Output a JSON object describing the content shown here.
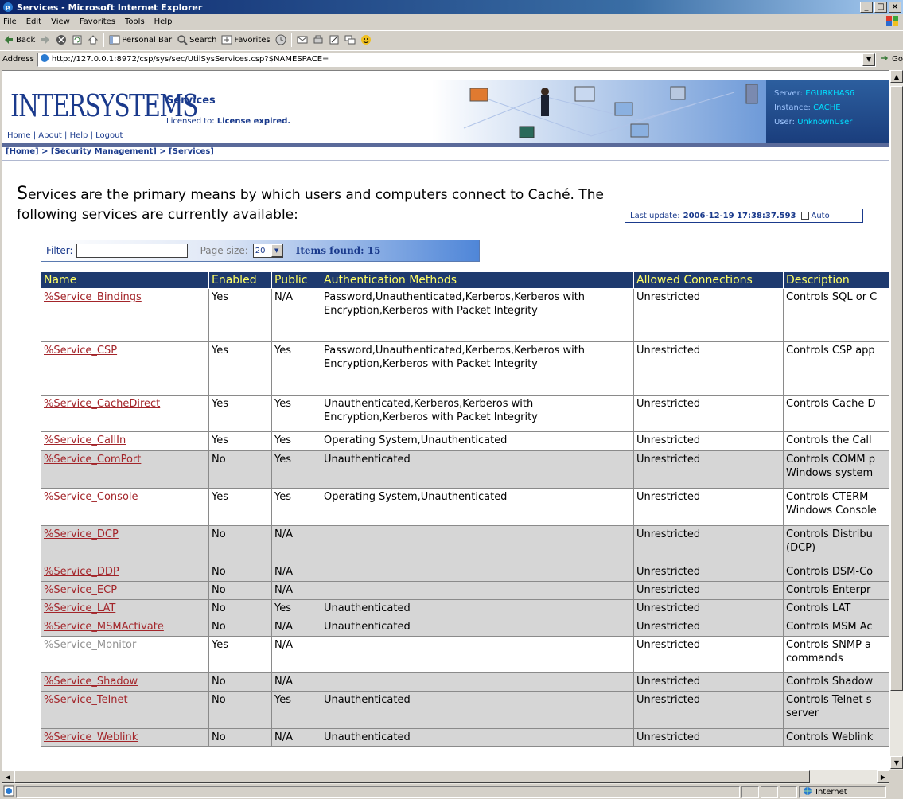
{
  "window": {
    "title": "Services - Microsoft Internet Explorer",
    "buttons": [
      "_",
      "□",
      "×"
    ]
  },
  "menu": [
    "File",
    "Edit",
    "View",
    "Favorites",
    "Tools",
    "Help"
  ],
  "toolbar": {
    "back": "Back",
    "personal_bar": "Personal Bar",
    "search": "Search",
    "favorites": "Favorites"
  },
  "address": {
    "label": "Address",
    "url": "http://127.0.0.1:8972/csp/sys/sec/UtilSysServices.csp?$NAMESPACE=",
    "go": "Go"
  },
  "header": {
    "logo": "INTERSYSTEMS",
    "links": [
      "Home",
      "About",
      "Help",
      "Logout"
    ],
    "title": "Services",
    "license_label": "Licensed to:",
    "license_value": "License expired.",
    "server_label": "Server:",
    "server_value": "EGURKHAS6",
    "instance_label": "Instance:",
    "instance_value": "CACHE",
    "user_label": "User:",
    "user_value": "UnknownUser"
  },
  "breadcrumb": "[Home] > [Security Management] > [Services]",
  "intro": "Services are the primary means by which users and computers connect to Caché. The following services are currently available:",
  "last_update": {
    "label": "Last update:",
    "value": "2006-12-19 17:38:37.593",
    "auto": "Auto"
  },
  "filter": {
    "label": "Filter:",
    "page_size_label": "Page size:",
    "page_size": "20",
    "items_found": "Items found: 15"
  },
  "columns": [
    "Name",
    "Enabled",
    "Public",
    "Authentication Methods",
    "Allowed Connections",
    "Description"
  ],
  "rows": [
    {
      "name": "%Service_Bindings",
      "enabled": "Yes",
      "public": "N/A",
      "auth": "Password,Unauthenticated,Kerberos,Kerberos with Encryption,Kerberos with Packet Integrity",
      "conn": "Unrestricted",
      "desc": "Controls SQL or C"
    },
    {
      "name": "%Service_CSP",
      "enabled": "Yes",
      "public": "Yes",
      "auth": "Password,Unauthenticated,Kerberos,Kerberos with Encryption,Kerberos with Packet Integrity",
      "conn": "Unrestricted",
      "desc": "Controls CSP app"
    },
    {
      "name": "%Service_CacheDirect",
      "enabled": "Yes",
      "public": "Yes",
      "auth": "Unauthenticated,Kerberos,Kerberos with Encryption,Kerberos with Packet Integrity",
      "conn": "Unrestricted",
      "desc": "Controls Cache D"
    },
    {
      "name": "%Service_CallIn",
      "enabled": "Yes",
      "public": "Yes",
      "auth": "Operating System,Unauthenticated",
      "conn": "Unrestricted",
      "desc": "Controls the Call"
    },
    {
      "name": "%Service_ComPort",
      "enabled": "No",
      "public": "Yes",
      "auth": "Unauthenticated",
      "conn": "Unrestricted",
      "desc": "Controls COMM p Windows system"
    },
    {
      "name": "%Service_Console",
      "enabled": "Yes",
      "public": "Yes",
      "auth": "Operating System,Unauthenticated",
      "conn": "Unrestricted",
      "desc": "Controls CTERM Windows Console"
    },
    {
      "name": "%Service_DCP",
      "enabled": "No",
      "public": "N/A",
      "auth": "",
      "conn": "Unrestricted",
      "desc": "Controls Distribu (DCP)"
    },
    {
      "name": "%Service_DDP",
      "enabled": "No",
      "public": "N/A",
      "auth": "",
      "conn": "Unrestricted",
      "desc": "Controls DSM-Co"
    },
    {
      "name": "%Service_ECP",
      "enabled": "No",
      "public": "N/A",
      "auth": "",
      "conn": "Unrestricted",
      "desc": "Controls Enterpr"
    },
    {
      "name": "%Service_LAT",
      "enabled": "No",
      "public": "Yes",
      "auth": "Unauthenticated",
      "conn": "Unrestricted",
      "desc": "Controls LAT"
    },
    {
      "name": "%Service_MSMActivate",
      "enabled": "No",
      "public": "N/A",
      "auth": "Unauthenticated",
      "conn": "Unrestricted",
      "desc": "Controls MSM Ac"
    },
    {
      "name": "%Service_Monitor",
      "enabled": "Yes",
      "public": "N/A",
      "auth": "",
      "conn": "Unrestricted",
      "desc": "Controls SNMP a commands"
    },
    {
      "name": "%Service_Shadow",
      "enabled": "No",
      "public": "N/A",
      "auth": "",
      "conn": "Unrestricted",
      "desc": "Controls Shadow"
    },
    {
      "name": "%Service_Telnet",
      "enabled": "No",
      "public": "Yes",
      "auth": "Unauthenticated",
      "conn": "Unrestricted",
      "desc": "Controls Telnet s server"
    },
    {
      "name": "%Service_Weblink",
      "enabled": "No",
      "public": "N/A",
      "auth": "Unauthenticated",
      "conn": "Unrestricted",
      "desc": "Controls Weblink"
    }
  ],
  "status": {
    "zone": "Internet"
  }
}
